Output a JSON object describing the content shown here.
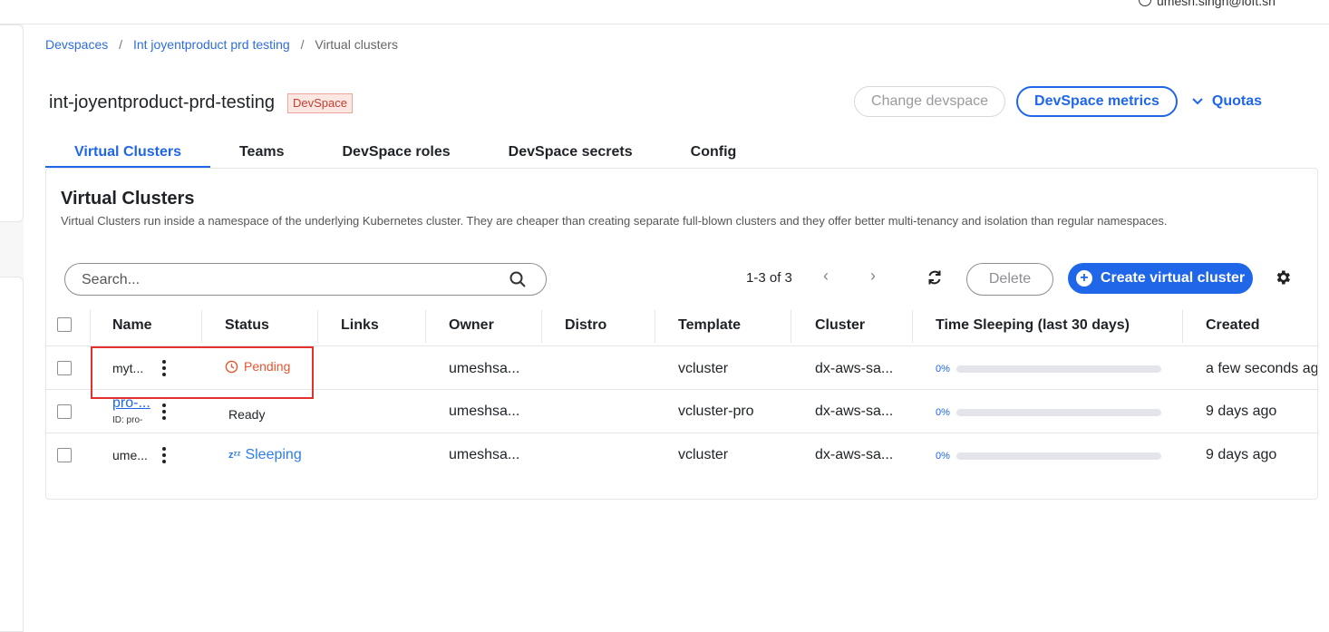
{
  "topbar": {
    "user_text": "umesh.singh@loft.sh"
  },
  "breadcrumb": {
    "items": [
      "Devspaces",
      "Int joyentproduct prd testing",
      "Virtual clusters"
    ],
    "separator": "/"
  },
  "header": {
    "title": "int-joyentproduct-prd-testing",
    "badge": "DevSpace",
    "change_devspace": "Change devspace",
    "devspace_metrics": "DevSpace metrics",
    "quotas": "Quotas"
  },
  "tabs": [
    {
      "label": "Virtual Clusters",
      "active": true
    },
    {
      "label": "Teams",
      "active": false
    },
    {
      "label": "DevSpace roles",
      "active": false
    },
    {
      "label": "DevSpace secrets",
      "active": false
    },
    {
      "label": "Config",
      "active": false
    }
  ],
  "card": {
    "title": "Virtual Clusters",
    "description": "Virtual Clusters run inside a namespace of the underlying Kubernetes cluster. They are cheaper than creating separate full-blown clusters and they offer better multi-tenancy and isolation than regular namespaces."
  },
  "toolbar": {
    "search_placeholder": "Search...",
    "pagination": "1-3 of 3",
    "prev": "‹",
    "next": "›",
    "delete": "Delete",
    "create": "Create virtual cluster"
  },
  "table": {
    "columns": [
      "Name",
      "Status",
      "Links",
      "Owner",
      "Distro",
      "Template",
      "Cluster",
      "Time Sleeping (last 30 days)",
      "Created"
    ],
    "rows": [
      {
        "name": "myt...",
        "id": "",
        "status": "Pending",
        "status_type": "pending",
        "owner": "umeshsa...",
        "distro": "",
        "template": "vcluster",
        "cluster": "dx-aws-sa...",
        "sleep_pct": "0%",
        "sleep_value": 0,
        "created": "a few seconds ago"
      },
      {
        "name": "pro-...",
        "id": "ID: pro-",
        "status": "Ready",
        "status_type": "ready",
        "owner": "umeshsa...",
        "distro": "",
        "template": "vcluster-pro",
        "cluster": "dx-aws-sa...",
        "sleep_pct": "0%",
        "sleep_value": 0,
        "created": "9 days ago"
      },
      {
        "name": "ume...",
        "id": "",
        "status": "Sleeping",
        "status_type": "sleeping",
        "owner": "umeshsa...",
        "distro": "",
        "template": "vcluster",
        "cluster": "dx-aws-sa...",
        "sleep_pct": "0%",
        "sleep_value": 0,
        "created": "9 days ago"
      }
    ]
  },
  "colors": {
    "accent": "#1f66e8",
    "pending": "#e8552e",
    "highlight": "#e4312b",
    "badge_bg": "#fde7e3"
  }
}
